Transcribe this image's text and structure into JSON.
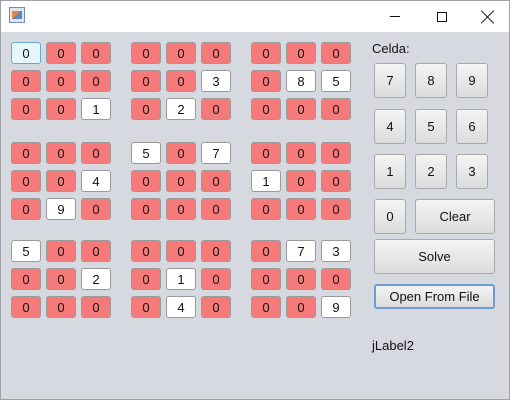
{
  "window": {
    "title": "",
    "app_icon": "java-cup-icon"
  },
  "grid_rows": [
    [
      "0",
      "0",
      "0",
      "0",
      "0",
      "0",
      "0",
      "0",
      "0"
    ],
    [
      "0",
      "0",
      "0",
      "0",
      "0",
      "3",
      "0",
      "8",
      "5"
    ],
    [
      "0",
      "0",
      "1",
      "0",
      "2",
      "0",
      "0",
      "0",
      "0"
    ],
    [
      "0",
      "0",
      "0",
      "5",
      "0",
      "7",
      "0",
      "0",
      "0"
    ],
    [
      "0",
      "0",
      "4",
      "0",
      "0",
      "0",
      "1",
      "0",
      "0"
    ],
    [
      "0",
      "9",
      "0",
      "0",
      "0",
      "0",
      "0",
      "0",
      "0"
    ],
    [
      "5",
      "0",
      "0",
      "0",
      "0",
      "0",
      "0",
      "7",
      "3"
    ],
    [
      "0",
      "0",
      "2",
      "0",
      "1",
      "0",
      "0",
      "0",
      "0"
    ],
    [
      "0",
      "0",
      "0",
      "0",
      "4",
      "0",
      "0",
      "0",
      "9"
    ]
  ],
  "selected_cell": [
    0,
    0
  ],
  "colors": {
    "empty_cell": "#f77a7a",
    "given_cell": "#ffffff",
    "selected_cell": "#e6f7fb",
    "background": "#d6d9df"
  },
  "panel": {
    "celda_label": "Celda:",
    "keypad": [
      "7",
      "8",
      "9",
      "4",
      "5",
      "6",
      "1",
      "2",
      "3"
    ],
    "zero_label": "0",
    "clear_label": "Clear",
    "solve_label": "Solve",
    "open_label": "Open From File",
    "status_label": "jLabel2"
  }
}
